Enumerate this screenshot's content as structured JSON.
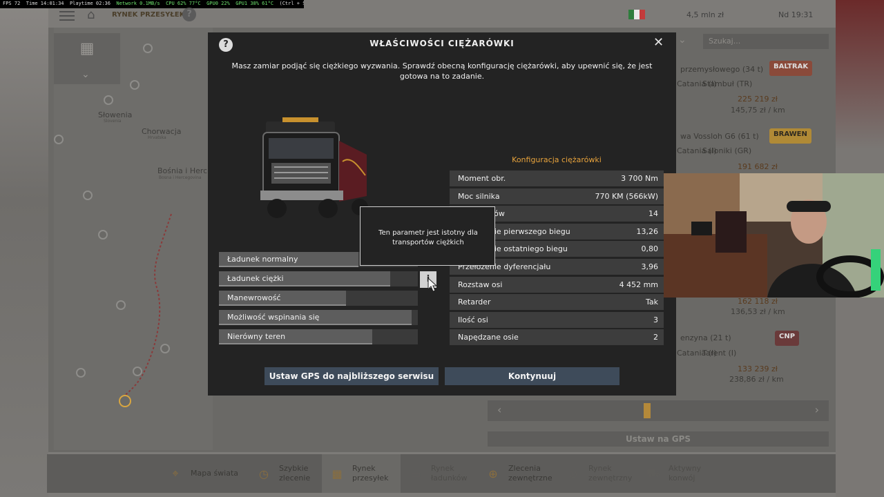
{
  "status_overlay": {
    "fps": "FPS 72",
    "time": "Time 14:01:34",
    "playtime": "Playtime 02:36",
    "network": "Network 0.1MB/s",
    "cpu": "CPU 62% 77°C",
    "gpu0": "GPU0 22%",
    "gpu1": "GPU1 38% 61°C",
    "hint": "(Ctrl + Shift + O)"
  },
  "topbar": {
    "breadcrumb": "RYNEK PRZESYŁEK",
    "help": "?",
    "money": "4,5 mln  zł",
    "clock": "Nd 19:31"
  },
  "map": {
    "labels": [
      "Słowenia",
      "Chorwacja",
      "Bośnia i Herce"
    ],
    "sublabels": [
      "Slovenia",
      "Hrvatska",
      "Bosna i Hercegovina"
    ]
  },
  "right_list": {
    "search_placeholder": "Szukaj...",
    "items": [
      {
        "title": "przemysłowego (34 t)",
        "route_from": "Catania (I)",
        "route_to": "Stambuł (TR)",
        "price": "225 219 zł",
        "per_km": "145,75 zł / km",
        "logo": "BALTRAK"
      },
      {
        "title": "wa Vossloh G6 (61 t)",
        "route_from": "Catania (I)",
        "route_to": "Saloniki (GR)",
        "price": "191 682 zł",
        "per_km": "",
        "logo": "BRAWEN"
      },
      {
        "title": "",
        "route_from": "",
        "route_to": "",
        "price": "162 118 zł",
        "per_km": "136,53 zł / km",
        "logo": ""
      },
      {
        "title": "enzyna (21 t)",
        "route_from": "Catania (I)",
        "route_to": "Tarent (I)",
        "price": "133 239 zł",
        "per_km": "238,86 zł / km",
        "logo": "CNP"
      }
    ],
    "gps_button": "Ustaw na GPS"
  },
  "bottom_nav": [
    {
      "label": "Mapa świata",
      "icon": "map-pin-icon",
      "active": false,
      "disabled": false
    },
    {
      "label": "Szybkie\nzlecenie",
      "icon": "clock-icon",
      "active": false,
      "disabled": false
    },
    {
      "label": "Rynek\nprzesyłek",
      "icon": "boxes-icon",
      "active": true,
      "disabled": false
    },
    {
      "label": "Rynek\nładunków",
      "icon": "trailer-icon",
      "active": false,
      "disabled": true
    },
    {
      "label": "Zlecenia\nzewnętrzne",
      "icon": "globe-icon",
      "active": false,
      "disabled": false
    },
    {
      "label": "Rynek\nzewnętrzny",
      "icon": "globe-truck-icon",
      "active": false,
      "disabled": true
    },
    {
      "label": "Aktywny\nkonwój",
      "icon": "convoy-icon",
      "active": false,
      "disabled": true
    }
  ],
  "dialog": {
    "help": "?",
    "title": "WŁAŚCIWOŚCI CIĘŻARÓWKI",
    "close": "✕",
    "description": "Masz zamiar podjąć się ciężkiego wyzwania. Sprawdź obecną konfigurację ciężarówki, aby upewnić się, że jest gotowa na to zadanie.",
    "attributes": [
      {
        "name": "Ładunek normalny",
        "level": 0.7
      },
      {
        "name": "Ładunek ciężki",
        "level": 0.86
      },
      {
        "name": "Manewrowość",
        "level": 0.64
      },
      {
        "name": "Możliwość wspinania się",
        "level": 0.97
      },
      {
        "name": "Nierówny teren",
        "level": 0.77
      }
    ],
    "info_button": "i",
    "tooltip": "Ten parametr jest istotny dla transportów ciężkich",
    "config_title": "Konfiguracja ciężarówki",
    "config": [
      {
        "key": "Moment obr.",
        "value": "3 700 Nm"
      },
      {
        "key": "Moc silnika",
        "value": "770 KM (566kW)"
      },
      {
        "key": "Ilość biegów",
        "value": "14"
      },
      {
        "key": "Przełożenie pierwszego biegu",
        "value": "13,26"
      },
      {
        "key": "Przełożenie ostatniego biegu",
        "value": "0,80"
      },
      {
        "key": "Przełożenie dyferencjału",
        "value": "3,96"
      },
      {
        "key": "Rozstaw osi",
        "value": "4 452 mm"
      },
      {
        "key": "Retarder",
        "value": "Tak"
      },
      {
        "key": "Ilość osi",
        "value": "3"
      },
      {
        "key": "Napędzane osie",
        "value": "2"
      }
    ],
    "gps_service_button": "Ustaw GPS do najbliższego serwisu",
    "continue_button": "Kontynuuj"
  },
  "colors": {
    "dialog_bg": "#232323",
    "accent_orange": "#e8a33c",
    "button_blue": "#3e4b5a"
  }
}
